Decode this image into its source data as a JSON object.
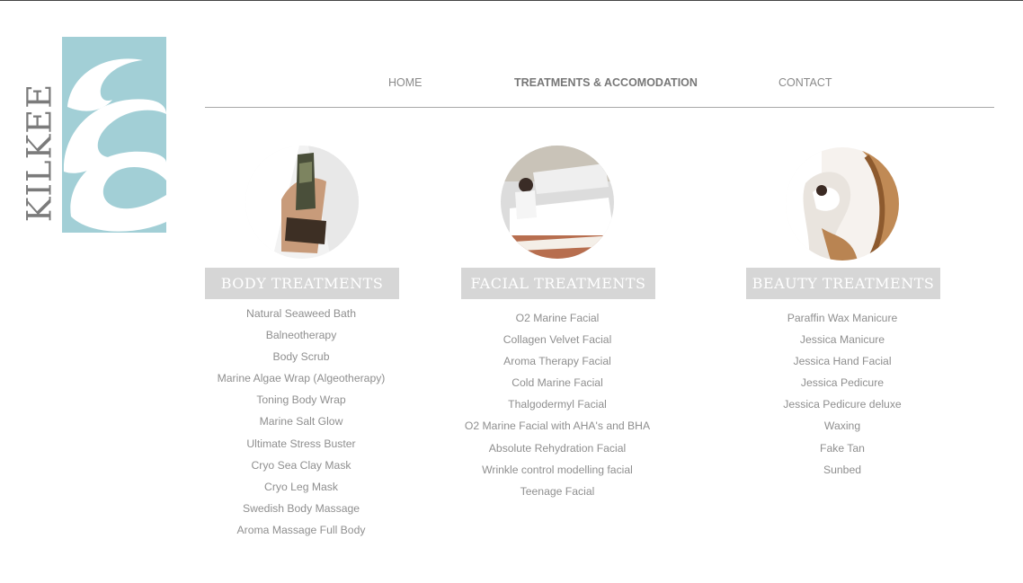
{
  "brand": {
    "name": "KILKEE",
    "logo_color": "#a2cfd6"
  },
  "nav": {
    "items": [
      {
        "label": "HOME",
        "active": false
      },
      {
        "label": "TREATMENTS & ACCOMODATION",
        "active": true
      },
      {
        "label": "CONTACT",
        "active": false
      }
    ]
  },
  "categories": [
    {
      "title": "BODY TREATMENTS",
      "items": [
        "Natural Seaweed Bath",
        "Balneotherapy",
        "Body Scrub",
        "Marine Algae Wrap (Algeotherapy)",
        "Toning Body Wrap",
        "Marine Salt Glow",
        "Ultimate Stress Buster",
        "Cryo Sea Clay Mask",
        "Cryo Leg Mask",
        "Swedish Body Massage",
        "Aroma Massage Full Body"
      ]
    },
    {
      "title": "FACIAL TREATMENTS",
      "items": [
        "O2 Marine Facial",
        "Collagen Velvet Facial",
        "Aroma Therapy Facial",
        "Cold Marine Facial",
        "Thalgodermyl Facial",
        "O2 Marine Facial with AHA's and BHA",
        "Absolute Rehydration Facial",
        "Wrinkle control modelling facial",
        "Teenage Facial"
      ]
    },
    {
      "title": "BEAUTY TREATMENTS",
      "items": [
        "Paraffin Wax Manicure",
        "Jessica Manicure",
        "Jessica Hand Facial",
        "Jessica Pedicure",
        "Jessica Pedicure deluxe",
        "Waxing",
        "Fake Tan",
        "Sunbed"
      ]
    }
  ]
}
